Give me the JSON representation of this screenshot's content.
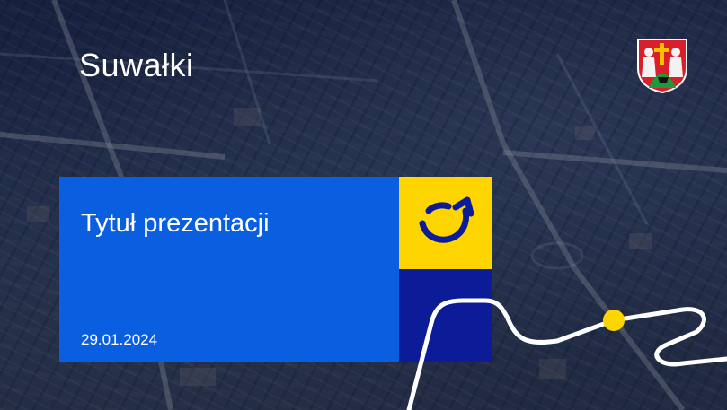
{
  "slide": {
    "brand": "Suwałki",
    "title": "Tytuł prezentacji",
    "date": "29.01.2024"
  },
  "colors": {
    "primary_blue": "#0a5ee0",
    "accent_yellow": "#ffd500",
    "navy": "#0c1c99",
    "line": "#ffffff",
    "dot": "#ffd500"
  },
  "icons": {
    "logo_mark": "smile-arrow-icon",
    "crest": "suwalki-coat-of-arms-icon"
  }
}
